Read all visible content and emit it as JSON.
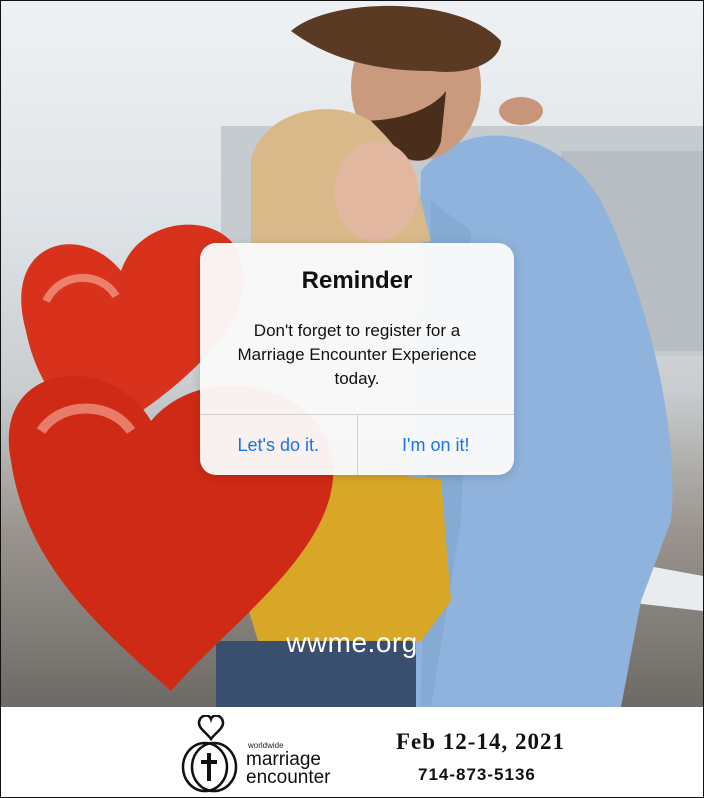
{
  "alert": {
    "title": "Reminder",
    "message": "Don't forget to register for a Marriage Encounter Experience today.",
    "primary_action": "Let's do it.",
    "secondary_action": "I'm on it!"
  },
  "website": "wwme.org",
  "logo": {
    "small_text": "worldwide",
    "line1": "marriage",
    "line2": "encounter"
  },
  "event": {
    "dates": "Feb 12-14, 2021",
    "phone": "714-873-5136"
  },
  "colors": {
    "action_blue": "#1a73e8",
    "balloon_red": "#d8321c",
    "shirt_blue": "#8fb3dc",
    "jacket_yellow": "#d9a728"
  },
  "icons": [
    "heart-icon",
    "cross-icon"
  ]
}
